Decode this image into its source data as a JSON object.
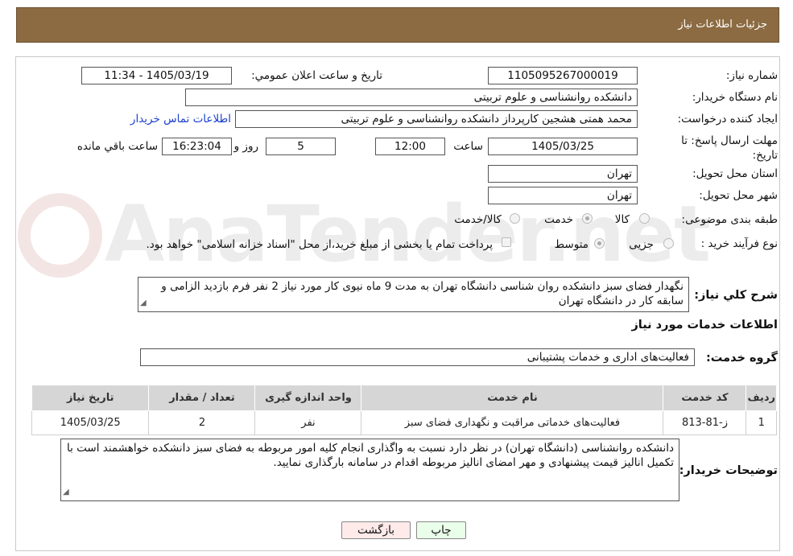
{
  "header": {
    "title": "جزئیات اطلاعات نیاز"
  },
  "watermark": {
    "text": "AnaTender.net"
  },
  "form": {
    "need_number_label": "شماره نیاز:",
    "need_number": "1105095267000019",
    "announce_label": "تاريخ و ساعت اعلان عمومي:",
    "announce_value": "1405/03/19 - 11:34",
    "buyer_org_label": "نام دستگاه خریدار:",
    "buyer_org": "دانشکده روانشناسی و علوم تربیتی",
    "creator_label": "ایجاد کننده درخواست:",
    "creator": "محمد همتی هشجین کارپرداز دانشکده روانشناسی و علوم تربیتی",
    "contact_link": "اطلاعات تماس خریدار",
    "deadline_label": "مهلت ارسال پاسخ: تا تاریخ:",
    "deadline_date": "1405/03/25",
    "time_label": "ساعت",
    "deadline_time": "12:00",
    "days_value": "5",
    "days_label": "روز و",
    "remaining_time": "16:23:04",
    "remaining_label": "ساعت باقي مانده",
    "province_label": "استان محل تحویل:",
    "province": "تهران",
    "city_label": "شهر محل تحویل:",
    "city": "تهران",
    "category_label": "طبقه بندی موضوعی:",
    "category_options": [
      "کالا",
      "خدمت",
      "کالا/خدمت"
    ],
    "process_label": "نوع فرآیند خرید :",
    "process_options": [
      "جزیی",
      "متوسط"
    ],
    "payment_note": "پرداخت تمام یا بخشی از مبلغ خرید،از محل \"اسناد خزانه اسلامی\" خواهد بود.",
    "summary_label": "شرح کلي نياز:",
    "summary": "نگهدار فضای سبز دانشکده روان شناسی دانشگاه تهران به مدت 9 ماه نیوی کار مورد نیاز 2 نفر  فرم بازدید الزامی و سابقه کار در دانشگاه تهران",
    "services_title": "اطلاعات خدمات مورد نیاز",
    "service_group_label": "گروه خدمت:",
    "service_group": "فعالیت‌های اداری و خدمات پشتیبانی",
    "buyer_notes_label": "توضیحات خریدار:",
    "buyer_notes": "دانشکده روانشناسی (دانشگاه تهران) در نظر دارد نسبت به واگذاری انجام کلیه امور مربوطه به فضای سبز دانشکده خواهشمند است با تکمیل انالیز قیمت پیشنهادی و مهر امضای انالیز  مربوطه اقدام در سامانه بارگذاری نمایید."
  },
  "table": {
    "headers": [
      "ردیف",
      "کد خدمت",
      "نام خدمت",
      "واحد اندازه گیری",
      "تعداد / مقدار",
      "تاریخ نیاز"
    ],
    "rows": [
      [
        "1",
        "ز-81-813",
        "فعالیت‌های خدماتی مراقبت و نگهداری فضای سبز",
        "نفر",
        "2",
        "1405/03/25"
      ]
    ]
  },
  "buttons": {
    "print": "چاپ",
    "back": "بازگشت"
  }
}
